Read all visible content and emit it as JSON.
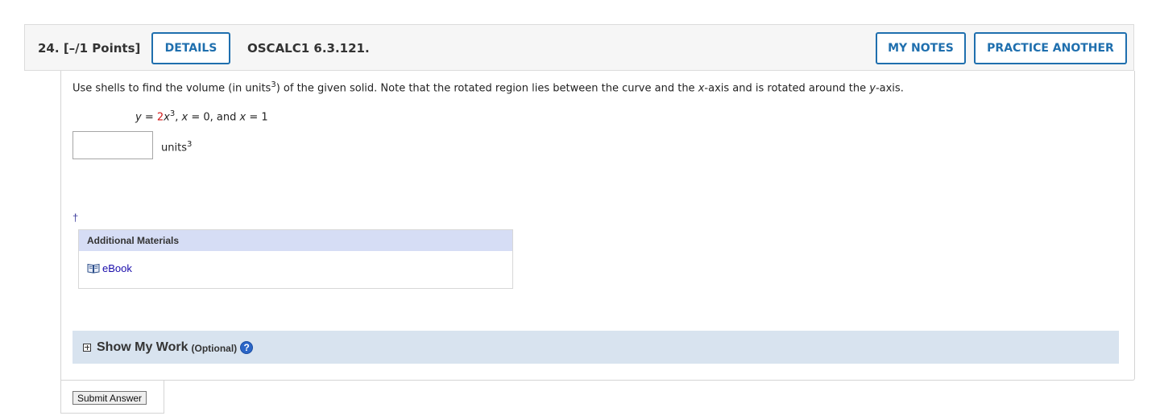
{
  "header": {
    "question_number": "24.",
    "points": "[–/1 Points]",
    "details_label": "DETAILS",
    "code": "OSCALC1 6.3.121.",
    "my_notes_label": "MY NOTES",
    "practice_label": "PRACTICE ANOTHER"
  },
  "problem": {
    "prompt_part1": "Use shells to find the volume (in units",
    "prompt_sup": "3",
    "prompt_part2": ") of the given solid. Note that the rotated region lies between the curve and the ",
    "prompt_x": "x",
    "prompt_part3": "-axis and is rotated around the ",
    "prompt_y": "y",
    "prompt_part4": "-axis.",
    "eq_y": "y",
    "eq_eq": " = ",
    "eq_coef": "2",
    "eq_x": "x",
    "eq_exp": "3",
    "eq_sep1": ", ",
    "eq_x2": "x",
    "eq_rest1": " = 0, and ",
    "eq_x3": "x",
    "eq_rest2": " = 1"
  },
  "answer": {
    "value": "",
    "units": "units",
    "units_sup": "3"
  },
  "footnote": "†",
  "materials": {
    "heading": "Additional Materials",
    "link": "eBook"
  },
  "show_work": {
    "label": "Show My Work",
    "optional": "(Optional)",
    "help": "?"
  },
  "submit_label": "Submit Answer"
}
